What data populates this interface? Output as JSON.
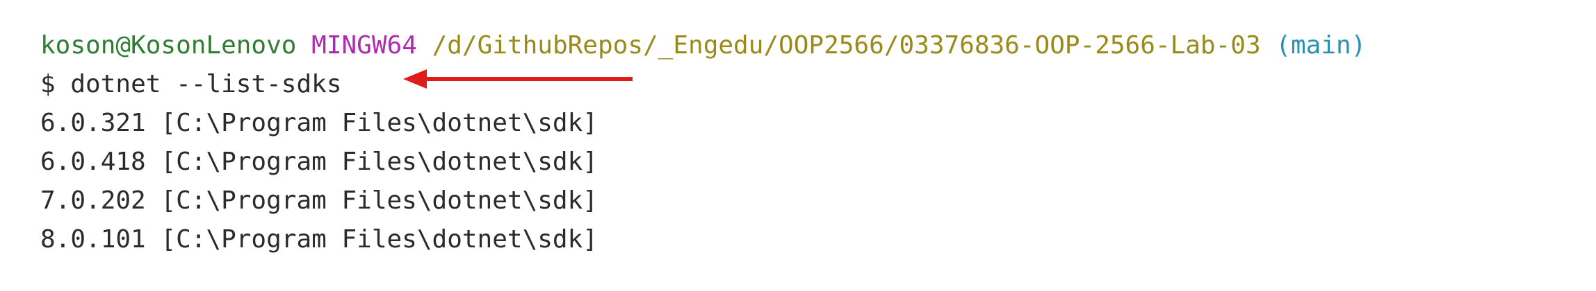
{
  "prompt": {
    "user_host": "koson@KosonLenovo",
    "env": "MINGW64",
    "path": "/d/GithubRepos/_Engedu/OOP2566/03376836-OOP-2566-Lab-03",
    "branch": "(main)"
  },
  "command": {
    "symbol": "$",
    "text": "dotnet --list-sdks"
  },
  "output": [
    "6.0.321 [C:\\Program Files\\dotnet\\sdk]",
    "6.0.418 [C:\\Program Files\\dotnet\\sdk]",
    "7.0.202 [C:\\Program Files\\dotnet\\sdk]",
    "8.0.101 [C:\\Program Files\\dotnet\\sdk]"
  ],
  "colors": {
    "user": "#2e7d32",
    "env": "#b02ab0",
    "path": "#9a8a1a",
    "branch": "#2a8fb5",
    "arrow": "#e01b1b"
  },
  "annotation_icon": "left-arrow-icon"
}
